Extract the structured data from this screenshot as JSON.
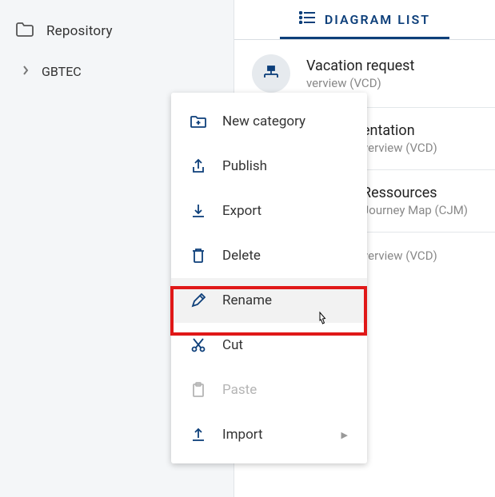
{
  "sidebar": {
    "title": "Repository",
    "items": [
      {
        "label": "GBTEC"
      }
    ]
  },
  "tab": {
    "label": "DIAGRAM LIST"
  },
  "diagrams": [
    {
      "title": "Vacation request",
      "sub": "verview (VCD)"
    },
    {
      "title": "entation",
      "sub": "verview (VCD)"
    },
    {
      "title": "Ressources",
      "sub": "Journey Map (CJM)"
    },
    {
      "title": "",
      "sub": "verview (VCD)"
    }
  ],
  "context_menu": [
    {
      "label": "New category"
    },
    {
      "label": "Publish"
    },
    {
      "label": "Export"
    },
    {
      "label": "Delete"
    },
    {
      "label": "Rename"
    },
    {
      "label": "Cut"
    },
    {
      "label": "Paste"
    },
    {
      "label": "Import"
    }
  ]
}
